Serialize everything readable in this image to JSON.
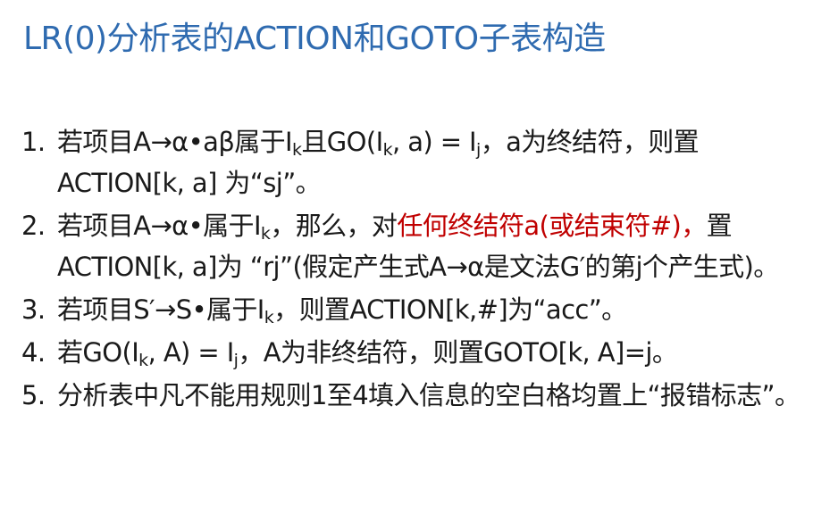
{
  "title": "LR(0)分析表的ACTION和GOTO子表构造",
  "items": [
    {
      "num": "1.",
      "p": {
        "a": "若项目A→α•aβ属于I",
        "b": "k",
        "c": "且GO(I",
        "d": "k",
        "e": ", a) = I",
        "f": "j",
        "g": "，a为终结符，则置ACTION[k, a] 为“sj”。"
      }
    },
    {
      "num": "2.",
      "p": {
        "a": "若项目A→α•属于I",
        "b": "k",
        "c": "，那么，对",
        "red": "任何终结符a(或结束符#)，",
        "d": "置ACTION[k, a]为 “rj”(假定产生式A→α是文法G′的第j个产生式)。"
      }
    },
    {
      "num": "3.",
      "p": {
        "a": "若项目S′→S•属于I",
        "b": "k",
        "c": "，则置ACTION[k,#]为“acc”。"
      }
    },
    {
      "num": "4.",
      "p": {
        "a": "若GO(I",
        "b": "k",
        "c": ", A) = I",
        "d": "j",
        "e": "，A为非终结符，则置GOTO[k, A]=j。"
      }
    },
    {
      "num": "5.",
      "p": {
        "a": "分析表中凡不能用规则1至4填入信息的空白格均置上“报错标志”。"
      }
    }
  ]
}
